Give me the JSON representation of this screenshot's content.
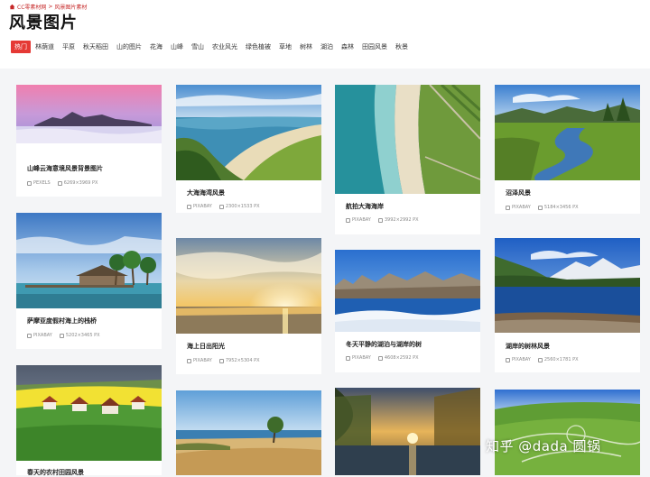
{
  "breadcrumb": {
    "home": "CC零素材网",
    "sep": ">",
    "current": "风景图片素材"
  },
  "page_title": "风景图片",
  "tabs": [
    "热门",
    "林荫道",
    "平原",
    "秋天稻田",
    "山的图片",
    "花海",
    "山峰",
    "雪山",
    "农业风光",
    "绿色植被",
    "草地",
    "树林",
    "湖泊",
    "森林",
    "田园风景",
    "秋景"
  ],
  "cards": [
    {
      "title": "山峰云海意境风景背景图片",
      "source": "PEXELS",
      "size": "6269×3969 PX"
    },
    {
      "title": "大海海湾风景",
      "source": "PIXABAY",
      "size": "2300×1533 PX"
    },
    {
      "title": "航拍大海海岸",
      "source": "PIXABAY",
      "size": "3992×2992 PX"
    },
    {
      "title": "沼泽风景",
      "source": "PIXABAY",
      "size": "5184×3456 PX"
    },
    {
      "title": "萨摩亚度假村海上的栈桥",
      "source": "PIXABAY",
      "size": "5202×3465 PX"
    },
    {
      "title": "海上日出阳光",
      "source": "PIXABAY",
      "size": "7952×5304 PX"
    },
    {
      "title": "冬天平静的湖泊与湖岸的树",
      "source": "PIXABAY",
      "size": "4608×2592 PX"
    },
    {
      "title": "湖岸的树林风景",
      "source": "PIXABAY",
      "size": "2560×1781 PX"
    },
    {
      "title": "春天的农村田园风景"
    }
  ],
  "watermark": "知乎 @dada 圆锅"
}
